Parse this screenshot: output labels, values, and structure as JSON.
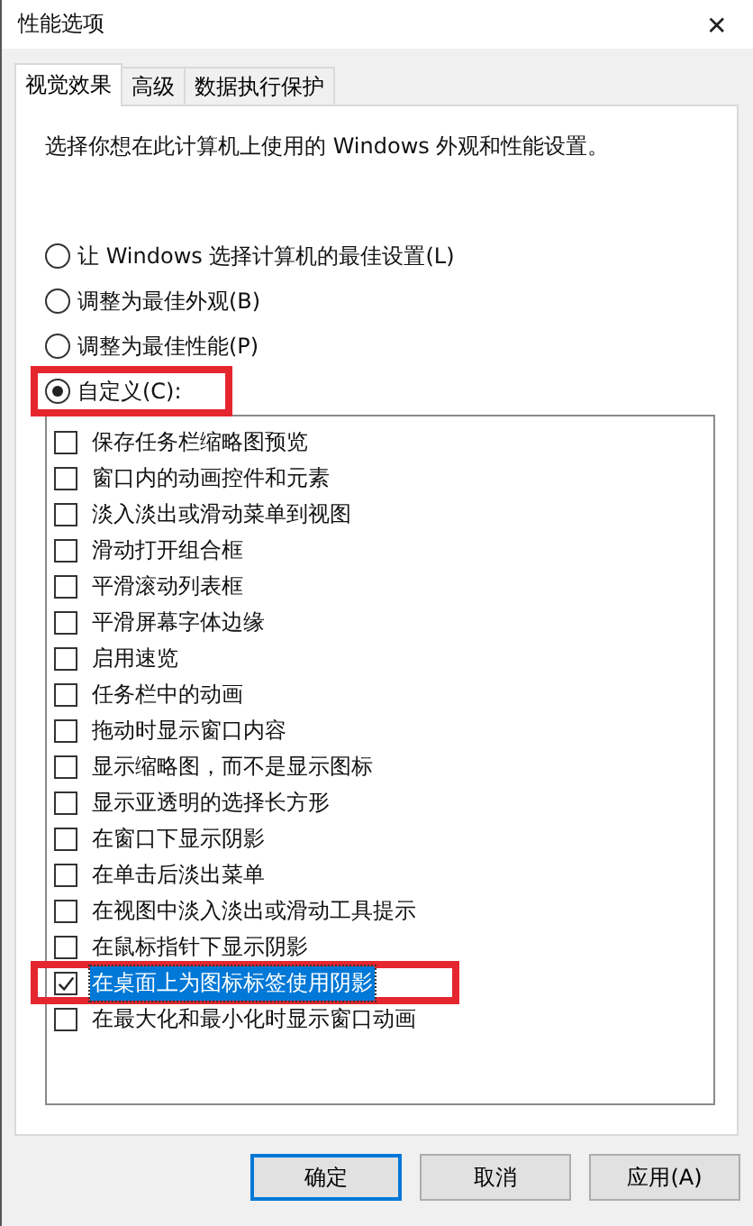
{
  "window": {
    "title": "性能选项",
    "close": "✕"
  },
  "tabs": [
    {
      "label": "视觉效果",
      "selected": true
    },
    {
      "label": "高级",
      "selected": false
    },
    {
      "label": "数据执行保护",
      "selected": false
    }
  ],
  "intro": "选择你想在此计算机上使用的 Windows 外观和性能设置。",
  "options": [
    {
      "label": "让 Windows 选择计算机的最佳设置(L)",
      "selected": false,
      "highlighted": false
    },
    {
      "label": "调整为最佳外观(B)",
      "selected": false,
      "highlighted": false
    },
    {
      "label": "调整为最佳性能(P)",
      "selected": false,
      "highlighted": false
    },
    {
      "label": "自定义(C):",
      "selected": true,
      "highlighted": true
    }
  ],
  "effects": [
    {
      "label": "保存任务栏缩略图预览",
      "checked": false,
      "selected": false,
      "highlighted": false
    },
    {
      "label": "窗口内的动画控件和元素",
      "checked": false,
      "selected": false,
      "highlighted": false
    },
    {
      "label": "淡入淡出或滑动菜单到视图",
      "checked": false,
      "selected": false,
      "highlighted": false
    },
    {
      "label": "滑动打开组合框",
      "checked": false,
      "selected": false,
      "highlighted": false
    },
    {
      "label": "平滑滚动列表框",
      "checked": false,
      "selected": false,
      "highlighted": false
    },
    {
      "label": "平滑屏幕字体边缘",
      "checked": false,
      "selected": false,
      "highlighted": false
    },
    {
      "label": "启用速览",
      "checked": false,
      "selected": false,
      "highlighted": false
    },
    {
      "label": "任务栏中的动画",
      "checked": false,
      "selected": false,
      "highlighted": false
    },
    {
      "label": "拖动时显示窗口内容",
      "checked": false,
      "selected": false,
      "highlighted": false
    },
    {
      "label": "显示缩略图，而不是显示图标",
      "checked": false,
      "selected": false,
      "highlighted": false
    },
    {
      "label": "显示亚透明的选择长方形",
      "checked": false,
      "selected": false,
      "highlighted": false
    },
    {
      "label": "在窗口下显示阴影",
      "checked": false,
      "selected": false,
      "highlighted": false
    },
    {
      "label": "在单击后淡出菜单",
      "checked": false,
      "selected": false,
      "highlighted": false
    },
    {
      "label": "在视图中淡入淡出或滑动工具提示",
      "checked": false,
      "selected": false,
      "highlighted": false
    },
    {
      "label": "在鼠标指针下显示阴影",
      "checked": false,
      "selected": false,
      "highlighted": false
    },
    {
      "label": "在桌面上为图标标签使用阴影",
      "checked": true,
      "selected": true,
      "highlighted": true
    },
    {
      "label": "在最大化和最小化时显示窗口动画",
      "checked": false,
      "selected": false,
      "highlighted": false
    }
  ],
  "buttons": [
    {
      "label": "确定",
      "default": true
    },
    {
      "label": "取消",
      "default": false
    },
    {
      "label": "应用(A)",
      "default": false
    }
  ]
}
